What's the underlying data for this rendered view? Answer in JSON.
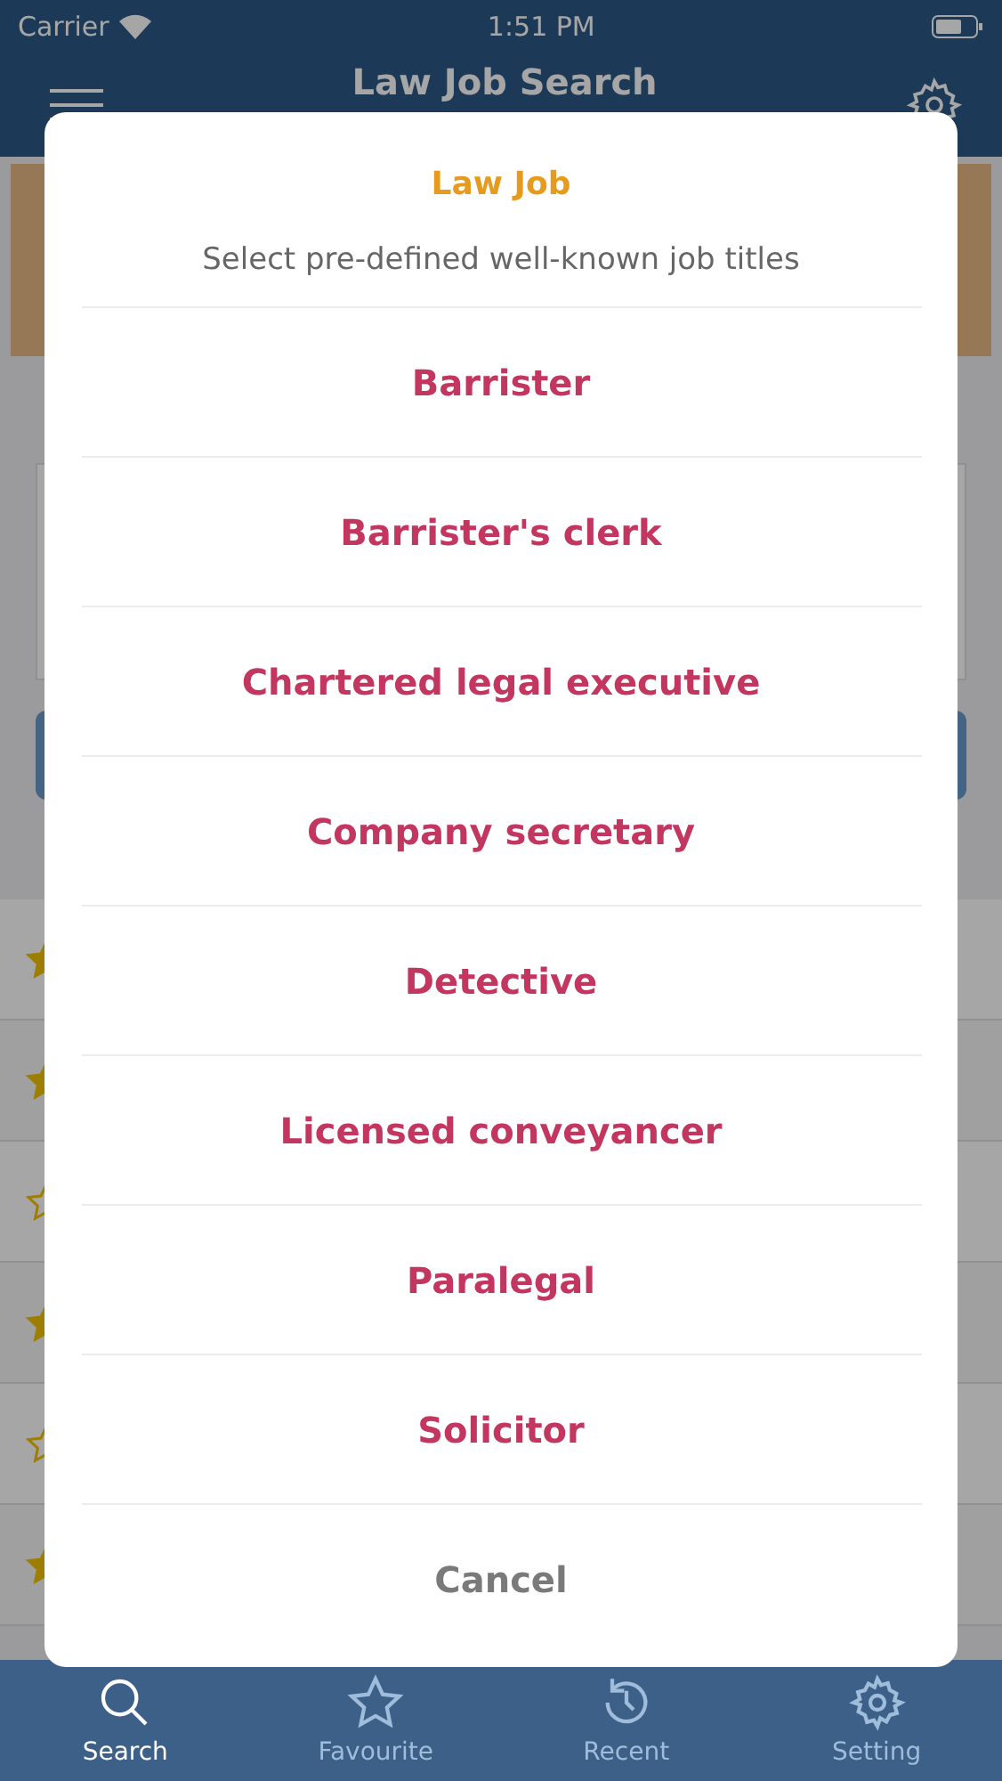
{
  "status_bar": {
    "carrier": "Carrier",
    "time": "1:51 PM"
  },
  "nav_bar": {
    "title": "Law Job Search"
  },
  "recent": {
    "rows": [
      {
        "starred": true
      },
      {
        "starred": true
      },
      {
        "starred": false
      },
      {
        "starred": true
      },
      {
        "starred": false
      },
      {
        "starred": true
      }
    ]
  },
  "dialog": {
    "title": "Law Job",
    "subtitle": "Select pre-defined well-known job titles",
    "options": [
      "Barrister",
      "Barrister's clerk",
      "Chartered legal executive",
      "Company secretary",
      "Detective",
      "Licensed conveyancer",
      "Paralegal",
      "Solicitor"
    ],
    "cancel": "Cancel"
  },
  "tab_bar": [
    {
      "kind": "search",
      "label": "Search",
      "selected": true
    },
    {
      "kind": "star",
      "label": "Favourite",
      "selected": false
    },
    {
      "kind": "history",
      "label": "Recent",
      "selected": false
    },
    {
      "kind": "gear",
      "label": "Setting",
      "selected": false
    }
  ]
}
